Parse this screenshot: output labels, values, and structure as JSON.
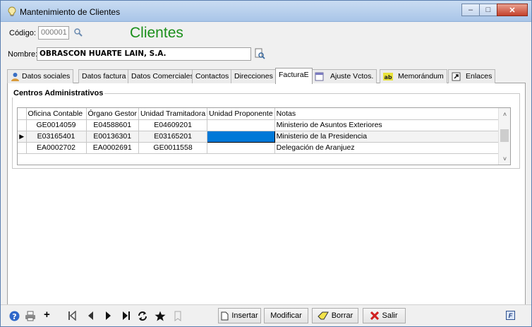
{
  "window": {
    "title": "Mantenimiento de Clientes",
    "minimize": "–",
    "maximize": "□",
    "close": "✕"
  },
  "header": {
    "codigo_label": "Código:",
    "codigo_value": "000001",
    "page_title": "Clientes",
    "nombre_label": "Nombre:",
    "nombre_value": "OBRASCON HUARTE LAIN, S.A."
  },
  "tabs": [
    {
      "label": "Datos sociales"
    },
    {
      "label": "Datos factura"
    },
    {
      "label": "Datos Comerciales"
    },
    {
      "label": "Contactos"
    },
    {
      "label": "Direcciones"
    },
    {
      "label": "FacturaE"
    },
    {
      "label": "Ajuste Vctos."
    },
    {
      "label": "Memorándum"
    },
    {
      "label": "Enlaces"
    }
  ],
  "group": {
    "title": "Centros Administrativos"
  },
  "grid": {
    "columns": [
      "Oficina Contable",
      "Órgano Gestor",
      "Unidad Tramitadora",
      "Unidad Proponente",
      "Notas"
    ],
    "rows": [
      {
        "oficina": "GE0014059",
        "organo": "E04588601",
        "unidad_tramitadora": "E04609201",
        "unidad_proponente": "",
        "notas": "Ministerio de Asuntos Exteriores"
      },
      {
        "oficina": "E03165401",
        "organo": "E00136301",
        "unidad_tramitadora": "E03165201",
        "unidad_proponente": "",
        "notas": "Ministerio de la Presidencia"
      },
      {
        "oficina": "EA0002702",
        "organo": "EA0002691",
        "unidad_tramitadora": "GE0011558",
        "unidad_proponente": "",
        "notas": "Delegación de Aranjuez"
      }
    ],
    "current_row_marker": "▶"
  },
  "toolbar": {
    "insert_label": "Insertar",
    "modify_label": "Modificar",
    "delete_label": "Borrar",
    "exit_label": "Salir",
    "plus": "+",
    "f_icon": "F"
  },
  "colors": {
    "title_green": "#1a8f1a",
    "selection_blue": "#0078d7"
  }
}
